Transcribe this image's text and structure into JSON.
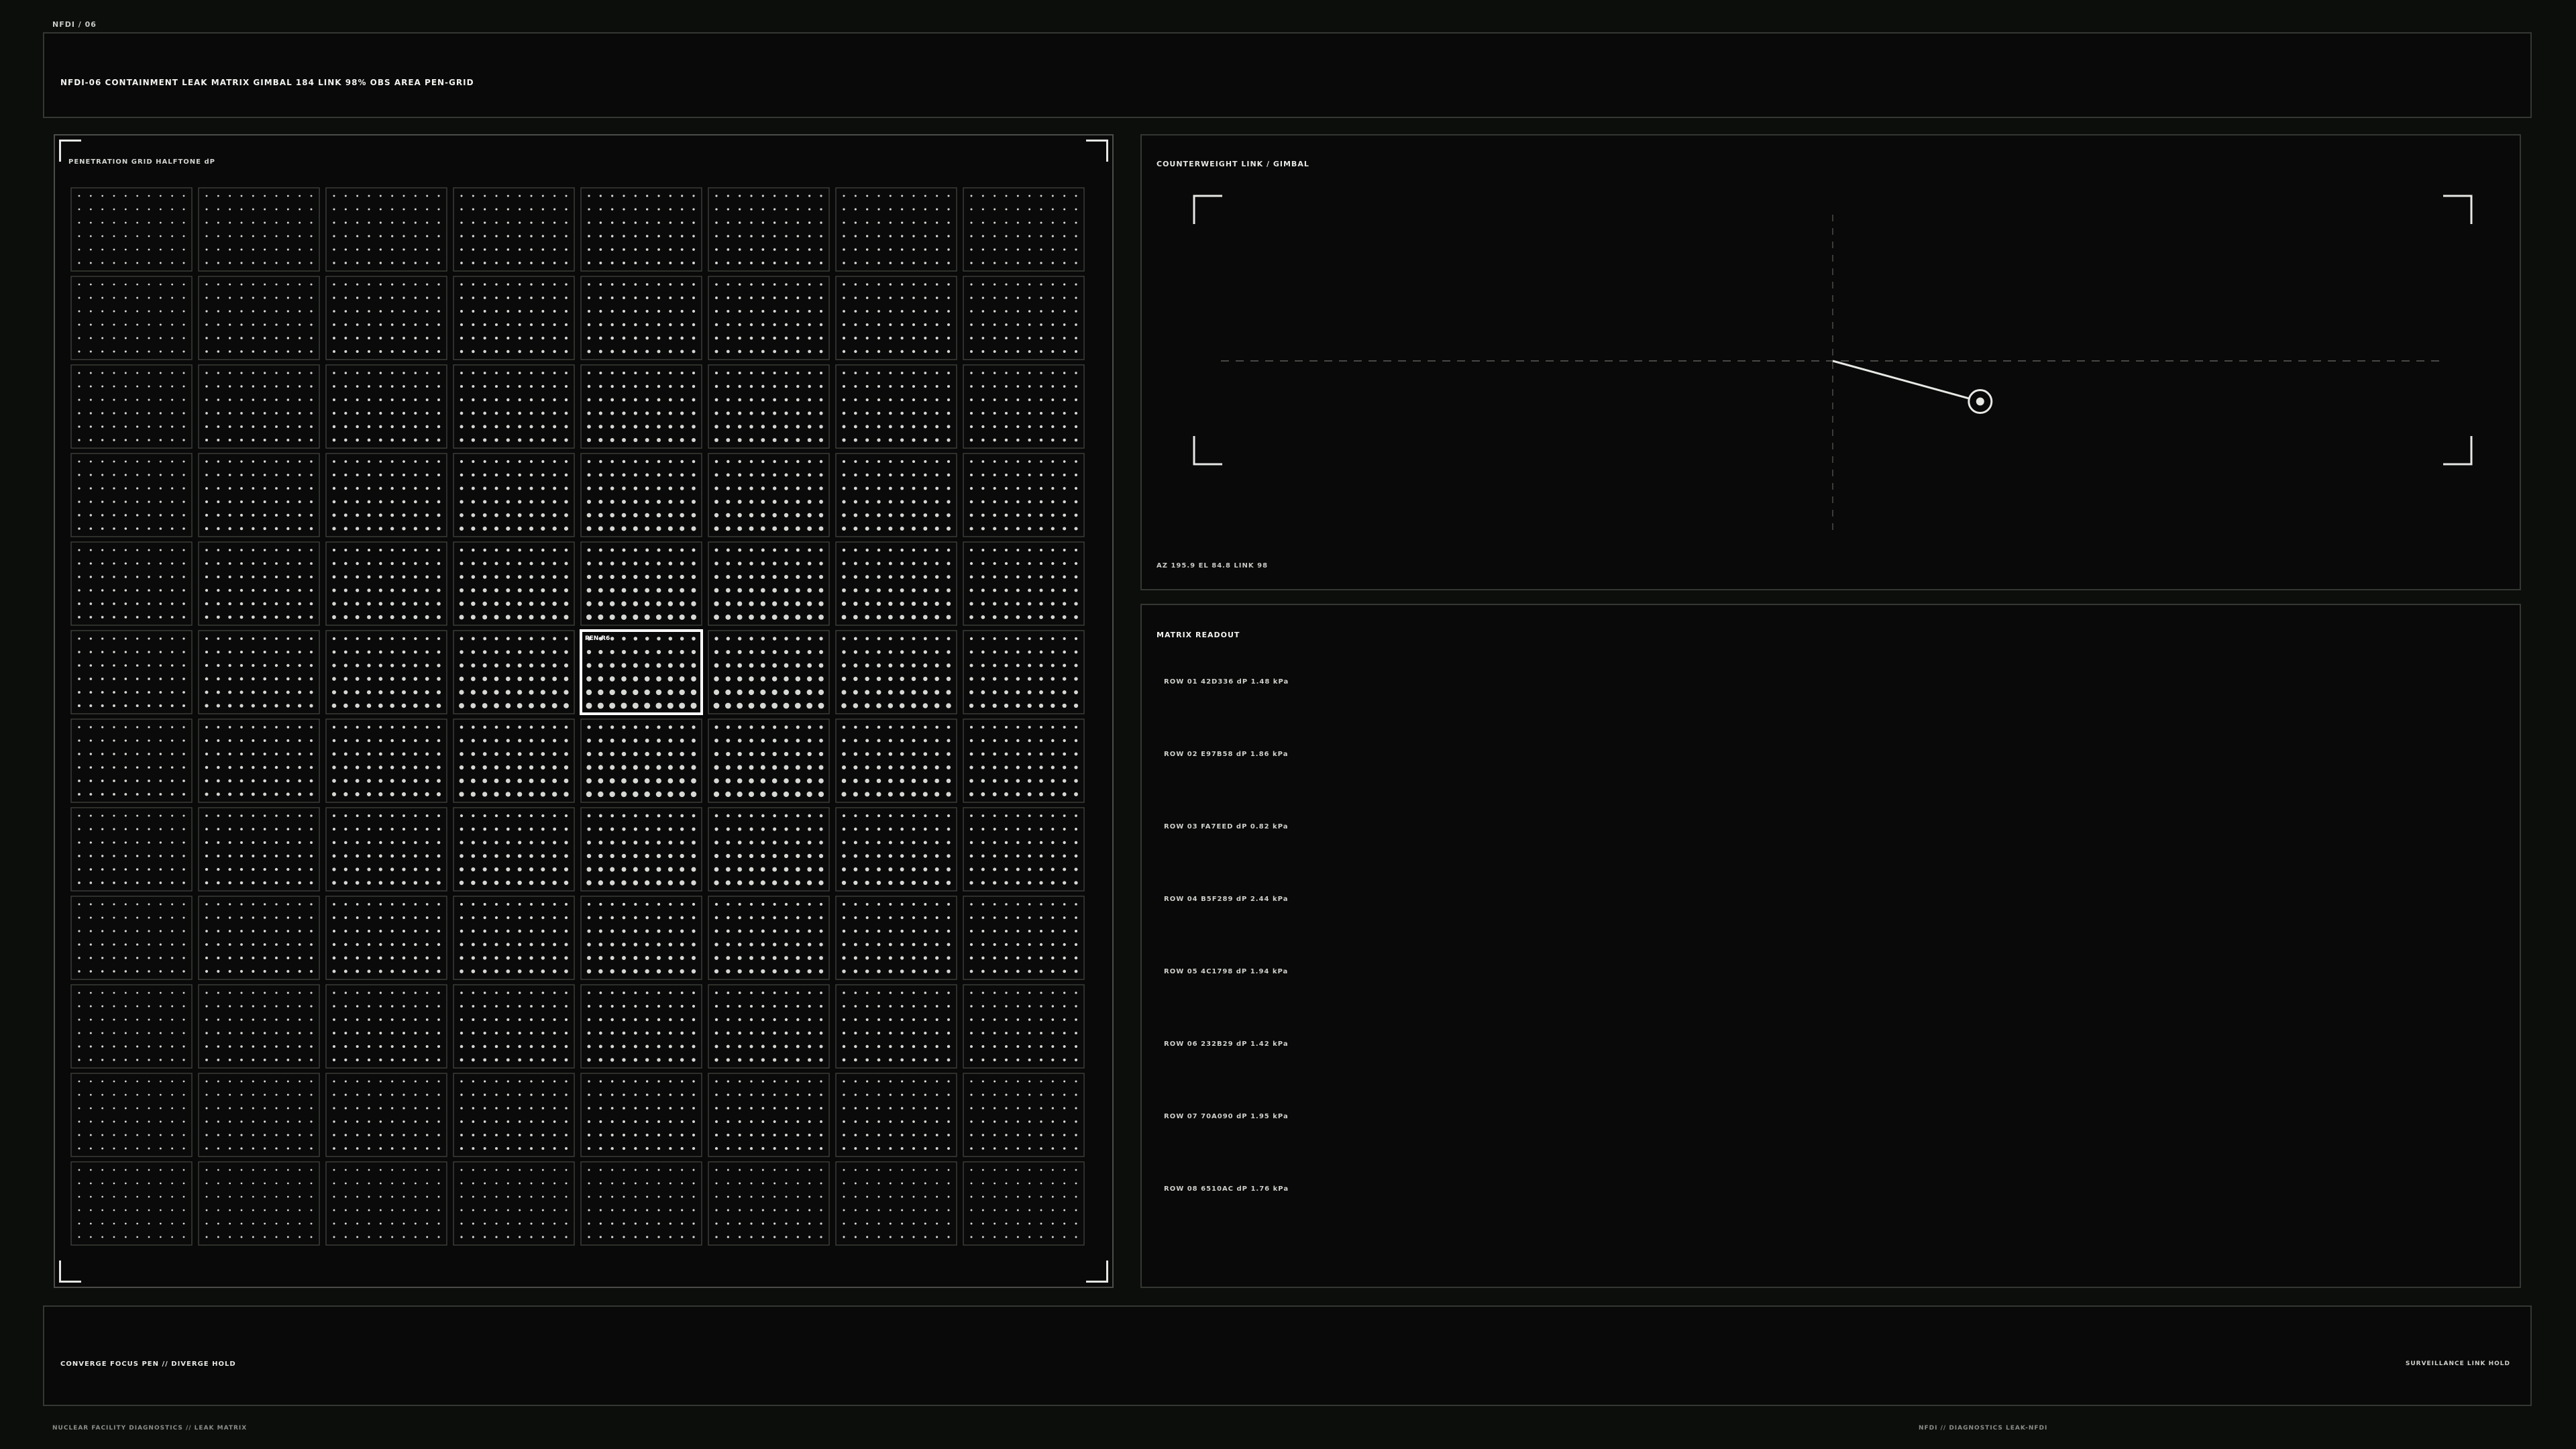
{
  "top_tag": "NFDI / 06",
  "header": {
    "title": "NFDI-06  CONTAINMENT LEAK MATRIX    GIMBAL 184  LINK 98%  OBS AREA PEN-GRID"
  },
  "matrix": {
    "title": "PENETRATION GRID HALFTONE dP",
    "cols": 8,
    "rows": 12,
    "selected": {
      "row": 6,
      "col": 5
    },
    "selected_label": "PEN-R6"
  },
  "gimbal": {
    "title": "COUNTERWEIGHT  LINK / GIMBAL",
    "readout": "AZ 195.9  EL 84.8  LINK 98",
    "arm_angle_deg": 15.4
  },
  "readout": {
    "title": "MATRIX READOUT",
    "rows": [
      {
        "text": "ROW 01  42D336  dP 1.48 kPa",
        "highlight": false
      },
      {
        "text": "ROW 02  E97B58  dP 1.86 kPa",
        "highlight": false
      },
      {
        "text": "ROW 03  FA7EED  dP 0.82 kPa",
        "highlight": false
      },
      {
        "text": "ROW 04  B5F289  dP 2.44 kPa",
        "highlight": false
      },
      {
        "text": "ROW 05  4C1798  dP 1.94 kPa",
        "highlight": true
      },
      {
        "text": "ROW 06  232B29  dP 1.42 kPa",
        "highlight": true
      },
      {
        "text": "ROW 07  70A090  dP 1.95 kPa",
        "highlight": false
      },
      {
        "text": "ROW 08  6510AC  dP 1.76 kPa",
        "highlight": false
      }
    ]
  },
  "footer": {
    "left": "CONVERGE  FOCUS PEN  //  DIVERGE HOLD",
    "right": "SURVEILLANCE LINK HOLD"
  },
  "bottom_left": "NUCLEAR FACILITY DIAGNOSTICS  //  LEAK MATRIX",
  "bottom_mid": "NFDI  //  DIAGNOSTICS LEAK-NFDI"
}
